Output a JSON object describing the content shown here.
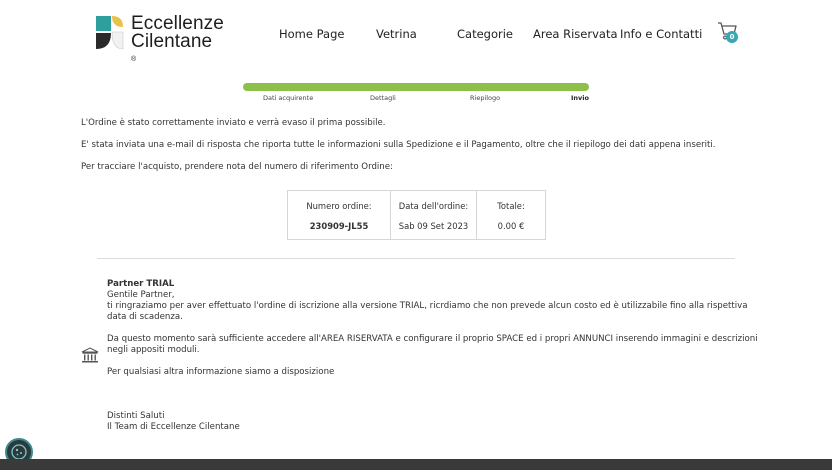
{
  "header": {
    "logo_line1": "Eccellenze",
    "logo_line2": "Cilentane",
    "logo_reg": "®",
    "nav": [
      "Home Page",
      "Vetrina",
      "Categorie",
      "Area Riservata",
      "Info e Contatti"
    ],
    "cart_count": "0",
    "cart_icon": "shopping-cart-icon"
  },
  "progress": {
    "steps": [
      "Dati acquirente",
      "Dettagli",
      "Riepilogo",
      "Invio"
    ],
    "active_step": "Invio",
    "complete_fraction": 1.0,
    "color": "#8dc04a"
  },
  "confirmation": {
    "line1": "L'Ordine è stato correttamente inviato e verrà evaso il prima possibile.",
    "line2": "E' stata inviata una e-mail di risposta che riporta tutte le informazioni sulla Spedizione e il Pagamento, oltre che il riepilogo dei dati appena inseriti.",
    "line3": "Per tracciare l'acquisto, prendere nota del numero di riferimento Ordine:"
  },
  "order": {
    "number_label": "Numero ordine:",
    "number_value": "230909-JL55",
    "date_label": "Data dell'ordine:",
    "date_value": "Sab 09 Set 2023",
    "total_label": "Totale:",
    "total_value": "0.00 €"
  },
  "partner": {
    "title": "Partner TRIAL",
    "greeting": "Gentile Partner,",
    "p1_line1": "ti ringraziamo per aver effettuato l'ordine di iscrizione alla versione TRIAL, ricrdiamo che non prevede alcun costo ed è utilizzabile fino alla rispettiva",
    "p1_line2": "data di scadenza.",
    "p2_line1": "Da questo momento sarà sufficiente accedere all'AREA RISERVATA e configurare il proprio SPACE ed i propri ANNUNCI inserendo immagini e descrizioni",
    "p2_line2": "negli appositi moduli.",
    "p3": "Per qualsiasi altra informazione siamo a disposizione",
    "closing1": "Distinti Saluti",
    "closing2": "Il Team di Eccellenze Cilentane",
    "icon": "bank-icon"
  },
  "accent_colors": {
    "brand_teal": "#38a9b4",
    "progress_green": "#8dc04a",
    "logo_yellow": "#e8c24a"
  }
}
